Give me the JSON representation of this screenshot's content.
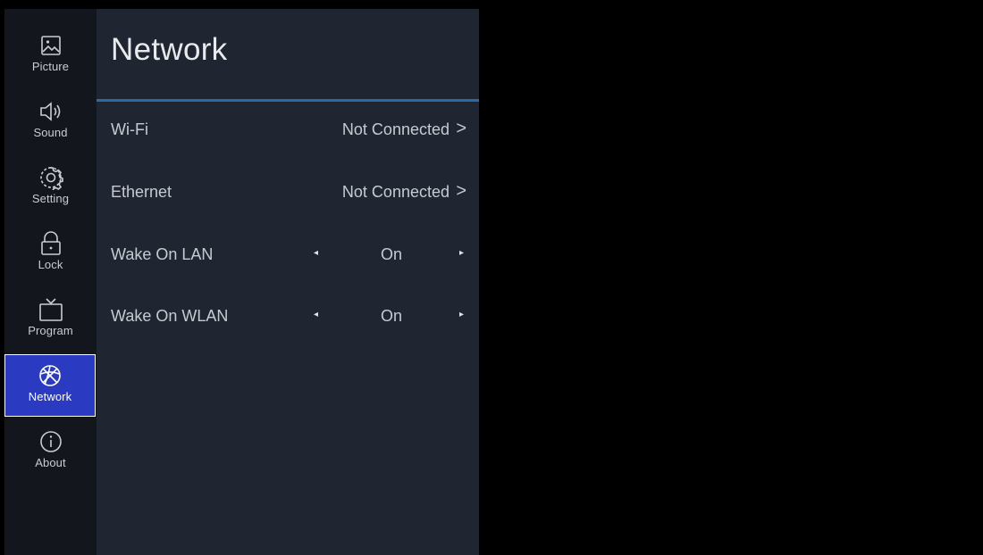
{
  "rail": {
    "items": [
      {
        "label": "Picture",
        "icon": "picture-icon"
      },
      {
        "label": "Sound",
        "icon": "speaker-icon"
      },
      {
        "label": "Setting",
        "icon": "gear-icon"
      },
      {
        "label": "Lock",
        "icon": "lock-icon"
      },
      {
        "label": "Program",
        "icon": "tv-icon"
      },
      {
        "label": "Network",
        "icon": "globe-icon",
        "active": true
      },
      {
        "label": "About",
        "icon": "info-icon"
      }
    ],
    "active_color": "#2a3bc1"
  },
  "panel": {
    "title": "Network",
    "divider_color": "#2c6aa6",
    "rows": [
      {
        "label": "Wi-Fi",
        "value": "Not Connected",
        "chevron": ">"
      },
      {
        "label": "Ethernet",
        "value": "Not Connected",
        "chevron": ">"
      },
      {
        "label": "Wake On LAN",
        "value": "On",
        "left_arrow": "◂",
        "right_arrow": "▸"
      },
      {
        "label": "Wake On WLAN",
        "value": "On",
        "left_arrow": "◂",
        "right_arrow": "▸"
      }
    ]
  }
}
